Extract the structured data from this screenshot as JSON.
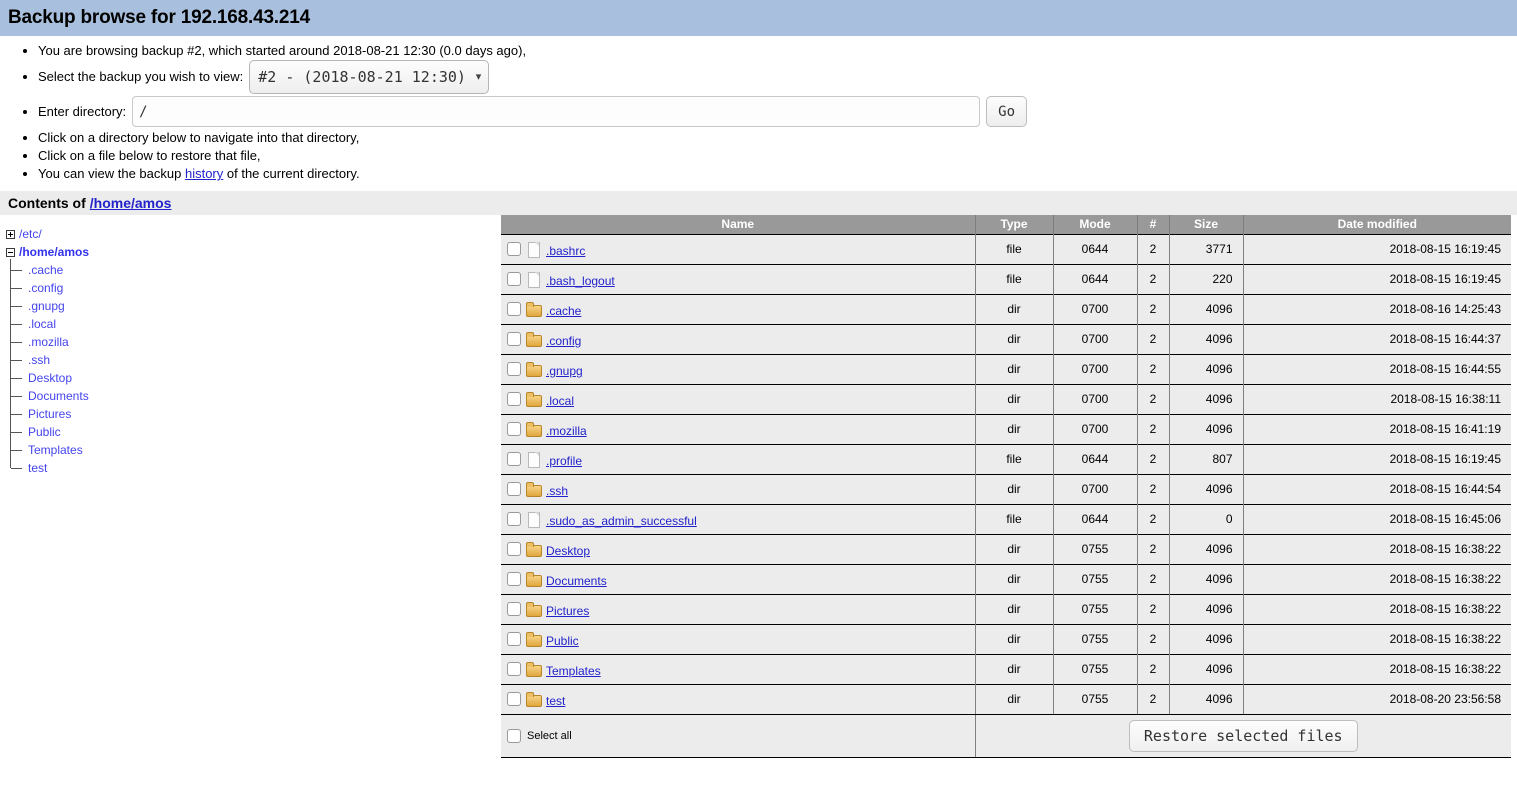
{
  "header": {
    "title": "Backup browse for 192.168.43.214"
  },
  "intro": {
    "browsing_note": "You are browsing backup #2, which started around 2018-08-21 12:30 (0.0 days ago),",
    "select_backup_label": "Select the backup you wish to view:",
    "backup_select_value": "#2 - (2018-08-21 12:30)",
    "backup_options": [
      "#2 - (2018-08-21 12:30)"
    ],
    "enter_directory_label": "Enter directory:",
    "directory_value": "/",
    "go_label": "Go",
    "tip_navigate": "Click on a directory below to navigate into that directory,",
    "tip_restore": "Click on a file below to restore that file,",
    "tip_history_prefix": "You can view the backup ",
    "tip_history_link": "history",
    "tip_history_suffix": " of the current directory."
  },
  "contents": {
    "label": "Contents of",
    "path": "/home/amos"
  },
  "tree": {
    "etc": {
      "label": "/etc/",
      "state": "collapsed"
    },
    "home": {
      "label": "/home/amos",
      "state": "expanded"
    },
    "children": [
      {
        "label": ".cache"
      },
      {
        "label": ".config"
      },
      {
        "label": ".gnupg"
      },
      {
        "label": ".local"
      },
      {
        "label": ".mozilla"
      },
      {
        "label": ".ssh"
      },
      {
        "label": "Desktop"
      },
      {
        "label": "Documents"
      },
      {
        "label": "Pictures"
      },
      {
        "label": "Public"
      },
      {
        "label": "Templates"
      },
      {
        "label": "test"
      }
    ]
  },
  "table": {
    "columns": [
      "Name",
      "Type",
      "Mode",
      "#",
      "Size",
      "Date modified"
    ],
    "rows": [
      {
        "name": ".bashrc",
        "icon": "file-icon",
        "type": "file",
        "mode": "0644",
        "links": "2",
        "size": "3771",
        "date": "2018-08-15 16:19:45"
      },
      {
        "name": ".bash_logout",
        "icon": "file-icon",
        "type": "file",
        "mode": "0644",
        "links": "2",
        "size": "220",
        "date": "2018-08-15 16:19:45"
      },
      {
        "name": ".cache",
        "icon": "folder-icon",
        "type": "dir",
        "mode": "0700",
        "links": "2",
        "size": "4096",
        "date": "2018-08-16 14:25:43"
      },
      {
        "name": ".config",
        "icon": "folder-icon",
        "type": "dir",
        "mode": "0700",
        "links": "2",
        "size": "4096",
        "date": "2018-08-15 16:44:37"
      },
      {
        "name": ".gnupg",
        "icon": "folder-icon",
        "type": "dir",
        "mode": "0700",
        "links": "2",
        "size": "4096",
        "date": "2018-08-15 16:44:55"
      },
      {
        "name": ".local",
        "icon": "folder-icon",
        "type": "dir",
        "mode": "0700",
        "links": "2",
        "size": "4096",
        "date": "2018-08-15 16:38:11"
      },
      {
        "name": ".mozilla",
        "icon": "folder-icon",
        "type": "dir",
        "mode": "0700",
        "links": "2",
        "size": "4096",
        "date": "2018-08-15 16:41:19"
      },
      {
        "name": ".profile",
        "icon": "file-icon",
        "type": "file",
        "mode": "0644",
        "links": "2",
        "size": "807",
        "date": "2018-08-15 16:19:45"
      },
      {
        "name": ".ssh",
        "icon": "folder-icon",
        "type": "dir",
        "mode": "0700",
        "links": "2",
        "size": "4096",
        "date": "2018-08-15 16:44:54"
      },
      {
        "name": ".sudo_as_admin_successful",
        "icon": "file-icon",
        "type": "file",
        "mode": "0644",
        "links": "2",
        "size": "0",
        "date": "2018-08-15 16:45:06"
      },
      {
        "name": "Desktop",
        "icon": "folder-icon",
        "type": "dir",
        "mode": "0755",
        "links": "2",
        "size": "4096",
        "date": "2018-08-15 16:38:22"
      },
      {
        "name": "Documents",
        "icon": "folder-icon",
        "type": "dir",
        "mode": "0755",
        "links": "2",
        "size": "4096",
        "date": "2018-08-15 16:38:22"
      },
      {
        "name": "Pictures",
        "icon": "folder-icon",
        "type": "dir",
        "mode": "0755",
        "links": "2",
        "size": "4096",
        "date": "2018-08-15 16:38:22"
      },
      {
        "name": "Public",
        "icon": "folder-icon",
        "type": "dir",
        "mode": "0755",
        "links": "2",
        "size": "4096",
        "date": "2018-08-15 16:38:22"
      },
      {
        "name": "Templates",
        "icon": "folder-icon",
        "type": "dir",
        "mode": "0755",
        "links": "2",
        "size": "4096",
        "date": "2018-08-15 16:38:22"
      },
      {
        "name": "test",
        "icon": "folder-icon",
        "type": "dir",
        "mode": "0755",
        "links": "2",
        "size": "4096",
        "date": "2018-08-20 23:56:58"
      }
    ],
    "footer": {
      "select_all_label": "Select all",
      "restore_label": "Restore selected files"
    }
  },
  "colors": {
    "title_bar": "#a8c0dd",
    "contents_bar": "#ececec",
    "table_header": "#999999",
    "row_bg": "#ececec",
    "link": "#2222cc",
    "tree_link": "#4444ee",
    "folder": "#e0a73c"
  }
}
